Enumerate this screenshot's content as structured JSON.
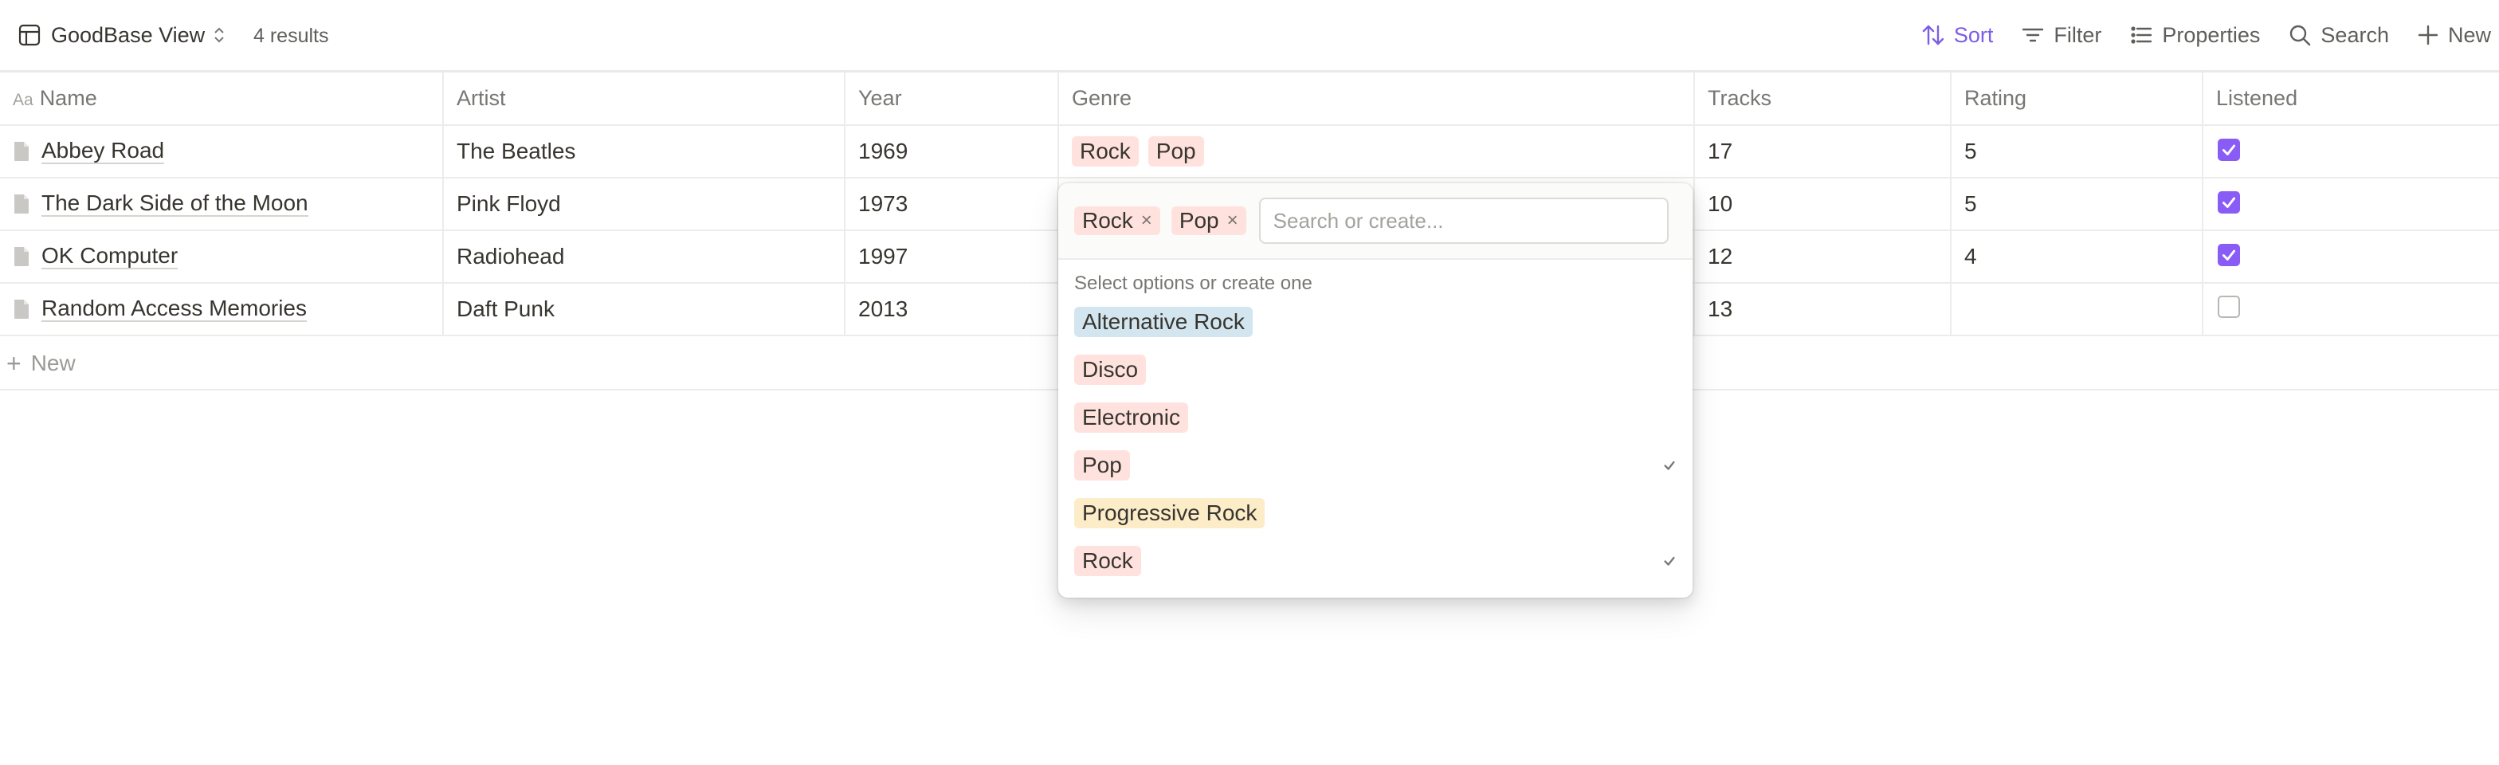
{
  "header": {
    "view_title": "GoodBase View",
    "results": "4 results",
    "actions": {
      "sort": "Sort",
      "filter": "Filter",
      "properties": "Properties",
      "search": "Search",
      "new": "New"
    }
  },
  "table": {
    "columns": {
      "name_prefix": "Aa",
      "name": "Name",
      "artist": "Artist",
      "year": "Year",
      "genre": "Genre",
      "tracks": "Tracks",
      "rating": "Rating",
      "listened": "Listened"
    },
    "rows": [
      {
        "name": "Abbey Road",
        "artist": "The Beatles",
        "year": "1969",
        "genres": [
          "Rock",
          "Pop"
        ],
        "tracks": "17",
        "rating": "5",
        "listened": true
      },
      {
        "name": "The Dark Side of the Moon",
        "artist": "Pink Floyd",
        "year": "1973",
        "genres": [],
        "tracks": "10",
        "rating": "5",
        "listened": true
      },
      {
        "name": "OK Computer",
        "artist": "Radiohead",
        "year": "1997",
        "genres": [],
        "tracks": "12",
        "rating": "4",
        "listened": true
      },
      {
        "name": "Random Access Memories",
        "artist": "Daft Punk",
        "year": "2013",
        "genres": [],
        "tracks": "13",
        "rating": "",
        "listened": false
      }
    ],
    "new_row_label": "New"
  },
  "genre_picker": {
    "selected": [
      "Rock",
      "Pop"
    ],
    "search_placeholder": "Search or create...",
    "hint": "Select options or create one",
    "options": [
      {
        "label": "Alternative Rock",
        "color": "#d3e5ef",
        "checked": false
      },
      {
        "label": "Disco",
        "color": "#ffe2dd",
        "checked": false
      },
      {
        "label": "Electronic",
        "color": "#ffe2dd",
        "checked": false
      },
      {
        "label": "Pop",
        "color": "#ffe2dd",
        "checked": true
      },
      {
        "label": "Progressive Rock",
        "color": "#fdecc8",
        "checked": false
      },
      {
        "label": "Rock",
        "color": "#ffe2dd",
        "checked": true
      }
    ],
    "tag_color_pink": "#ffe2dd"
  },
  "colors": {
    "accent": "#7c5de8",
    "checkbox": "#8a5cf6"
  },
  "icons": [
    "table-icon",
    "chevron-updown-icon",
    "sort-icon",
    "filter-icon",
    "properties-icon",
    "search-icon",
    "plus-icon",
    "page-icon",
    "checkmark-icon",
    "remove-x-icon"
  ]
}
